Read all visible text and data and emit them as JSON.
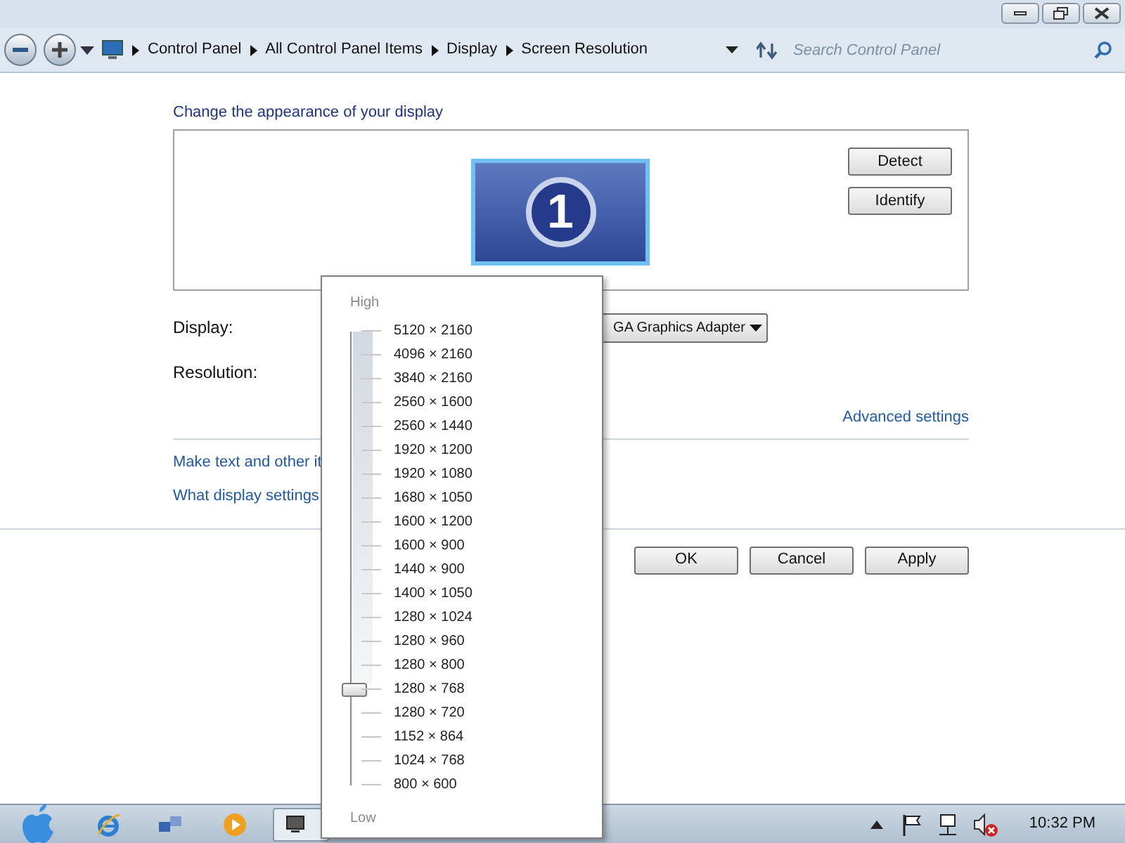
{
  "address_bar": {
    "breadcrumbs": [
      "Control Panel",
      "All Control Panel Items",
      "Display",
      "Screen Resolution"
    ],
    "search": {
      "placeholder": "Search Control Panel"
    }
  },
  "heading": "Change the appearance of your display",
  "monitor": {
    "number": "1",
    "selected": true
  },
  "side_buttons": [
    "Detect",
    "Identify"
  ],
  "display_label": "Display:",
  "display_value": "GA Graphics Adapter",
  "resolution_label": "Resolution:",
  "advanced_link": "Advanced settings",
  "links": [
    "Make text and other it",
    "What display settings"
  ],
  "buttons": [
    "OK",
    "Cancel",
    "Apply"
  ],
  "resolution_popup": {
    "high_label": "High",
    "low_label": "Low",
    "level": 0.21,
    "options": [
      "5120 × 2160",
      "4096 × 2160",
      "3840 × 2160",
      "2560 × 1600",
      "2560 × 1440",
      "1920 × 1200",
      "1920 × 1080",
      "1680 × 1050",
      "1600 × 1200",
      "1600 × 900",
      "1440 × 900",
      "1400 × 1050",
      "1280 × 1024",
      "1280 × 960",
      "1280 × 800",
      "1280 × 768",
      "1280 × 720",
      "1152 × 864",
      "1024 × 768",
      "800 × 600"
    ]
  },
  "taskbar": {
    "clock": "10:32 PM"
  }
}
